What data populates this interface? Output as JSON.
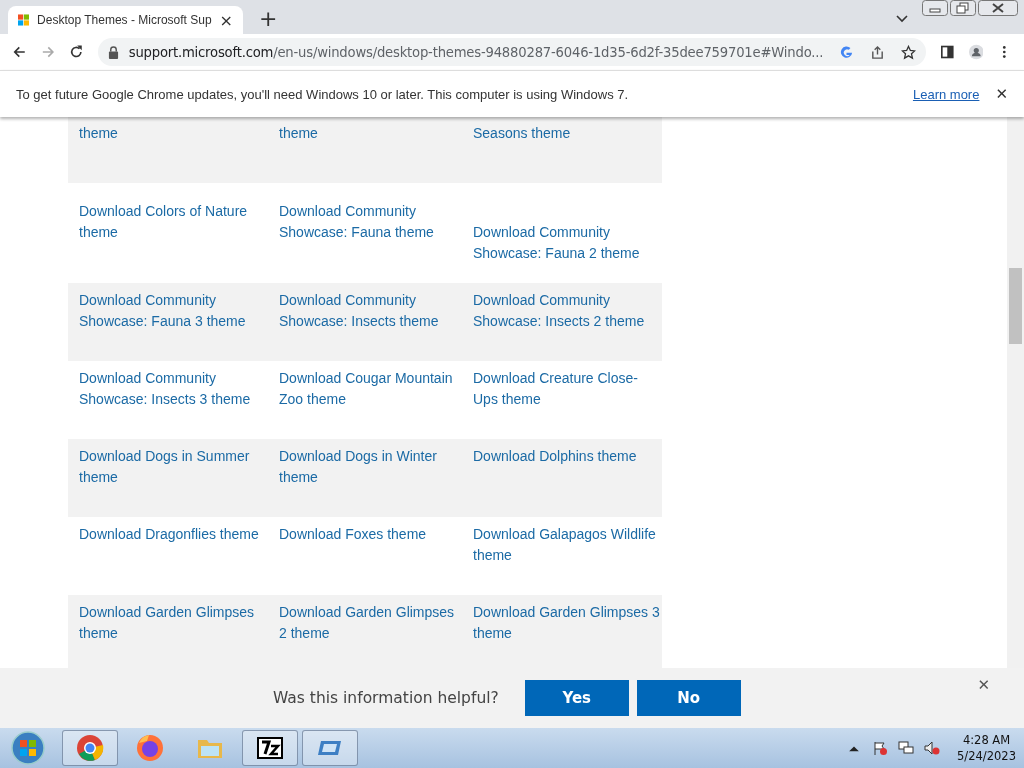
{
  "browser": {
    "tab": {
      "title": "Desktop Themes - Microsoft Sup",
      "close": "×"
    },
    "new_tab": "+",
    "address": {
      "host": "support.microsoft.com",
      "path": "/en-us/windows/desktop-themes-94880287-6046-1d35-6d2f-35dee759701e#Windo..."
    }
  },
  "info_bar": {
    "message": "To get future Google Chrome updates, you'll need Windows 10 or later. This computer is using Windows 7.",
    "link": "Learn more",
    "close": "✕"
  },
  "themes": [
    [
      {
        "kind": "link",
        "text": "theme"
      },
      {
        "kind": "link",
        "text": "theme"
      },
      {
        "kind": "link",
        "text": "Seasons theme"
      }
    ],
    [
      {
        "kind": "link",
        "text": "Download Colors of Nature theme"
      },
      {
        "kind": "link",
        "text": "Download Community Showcase: Fauna theme"
      },
      {
        "kind": "lowered",
        "text": "Download Community Showcase: Fauna 2 theme"
      }
    ],
    [
      {
        "kind": "link",
        "text": "Download Community Showcase: Fauna 3 theme"
      },
      {
        "kind": "link",
        "text": "Download Community Showcase: Insects theme"
      },
      {
        "kind": "link",
        "text": "Download Community Showcase: Insects 2 theme"
      }
    ],
    [
      {
        "kind": "link",
        "text": "Download Community Showcase: Insects 3 theme"
      },
      {
        "kind": "link",
        "text": "Download Cougar Mountain Zoo theme"
      },
      {
        "kind": "link",
        "text": "Download Creature Close-Ups theme"
      }
    ],
    [
      {
        "kind": "link",
        "text": "Download Dogs in Summer theme"
      },
      {
        "kind": "link",
        "text": "Download Dogs in Winter theme"
      },
      {
        "kind": "link",
        "text": "Download Dolphins theme"
      }
    ],
    [
      {
        "kind": "link",
        "text": "Download Dragonflies theme"
      },
      {
        "kind": "link",
        "text": "Download Foxes theme"
      },
      {
        "kind": "link",
        "text": "Download Galapagos Wildlife theme"
      }
    ],
    [
      {
        "kind": "link",
        "text": "Download Garden Glimpses theme"
      },
      {
        "kind": "link",
        "text": "Download Garden Glimpses 2 theme"
      },
      {
        "kind": "link",
        "text": "Download Garden Glimpses 3 theme"
      }
    ]
  ],
  "feedback": {
    "question": "Was this information helpful?",
    "buttons": [
      "Yes",
      "No"
    ],
    "close": "✕"
  },
  "taskbar": {
    "time": "4:28 AM",
    "date": "5/24/2023"
  }
}
